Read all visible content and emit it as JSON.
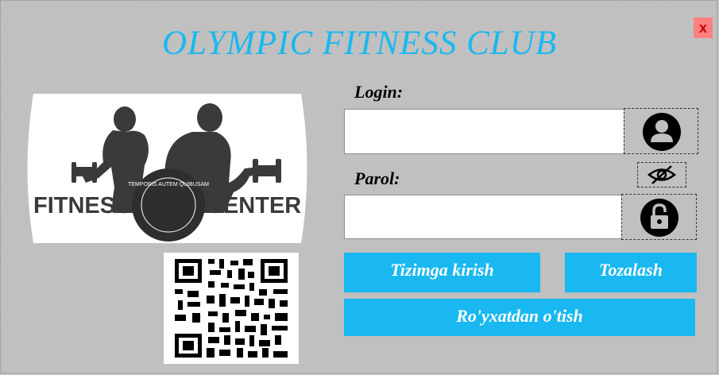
{
  "window": {
    "title": "OLYMPIC FITNESS CLUB",
    "close_label": "x"
  },
  "logo": {
    "left_word": "FITNESS",
    "right_word": "CENTER",
    "ring_text": "TEMPORIS AUTEM QUIBUSAM"
  },
  "login": {
    "label": "Login:",
    "value": "",
    "icon": "user-icon"
  },
  "password": {
    "label": "Parol:",
    "value": "",
    "toggle_icon": "eye-slash-icon",
    "icon": "lock-icon"
  },
  "buttons": {
    "login": "Tizimga kirish",
    "clear": "Tozalash",
    "register": "Ro'yxatdan o'tish"
  },
  "colors": {
    "accent": "#19b8f0",
    "background": "#c0c0c0",
    "close_bg": "#ff8080"
  }
}
